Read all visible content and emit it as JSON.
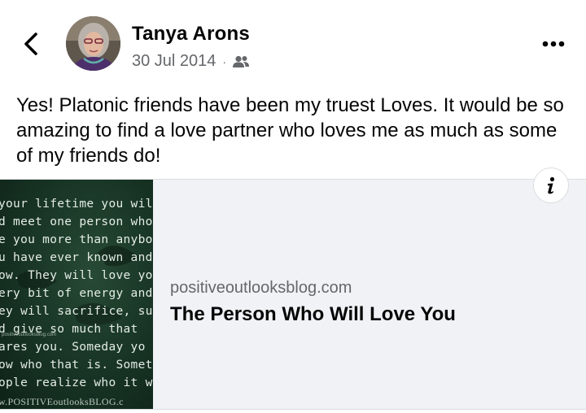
{
  "post": {
    "author": "Tanya Arons",
    "date": "30 Jul 2014",
    "separator": "·",
    "audience_icon": "friends-icon",
    "text": "Yes!  Platonic friends have been my truest Loves. It would be so amazing to find a love partner who loves me as much as some of my friends do!"
  },
  "link_preview": {
    "domain": "positiveoutlooksblog.com",
    "title": "The Person Who Will Love You",
    "thumbnail_lines": [
      "your lifetime you will f",
      "d meet one person who v",
      "e you more than anybo",
      "u have ever known and v",
      "ow. They will love you w",
      "ery bit of energy and sc",
      "ey will sacrifice, surrend",
      "d  give  so  much  that",
      "ares  you.  Someday  yo",
      "ow  who  that  is.  Sometim",
      "ople realize who it was. -"
    ],
    "thumbnail_small": "positiveoutlooksblog.com",
    "thumbnail_footer": "w.POSITIVEoutlooksBLOG.c"
  },
  "icons": {
    "back": "chevron-left-icon",
    "more": "more-horizontal-icon",
    "info": "info-icon"
  }
}
